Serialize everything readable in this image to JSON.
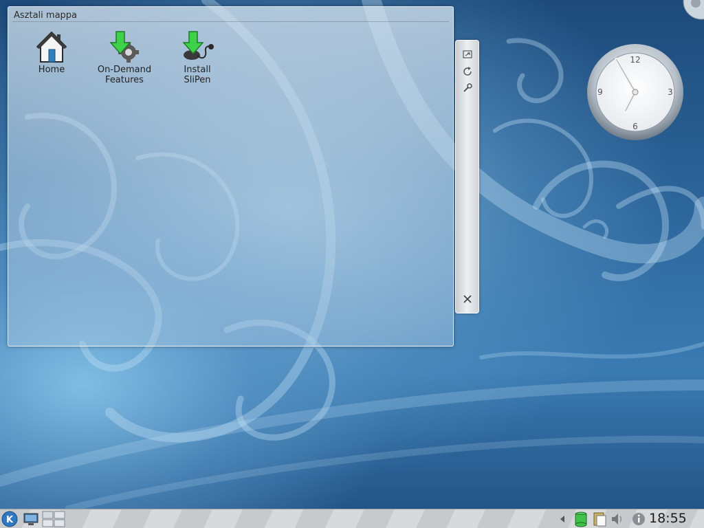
{
  "folder_view": {
    "title": "Asztali mappa",
    "icons": [
      {
        "label": "Home",
        "icon": "home-icon"
      },
      {
        "label": "On-Demand\nFeatures",
        "icon": "on-demand-features-icon"
      },
      {
        "label": "Install\nSliPen",
        "icon": "install-slipen-icon"
      }
    ]
  },
  "applet_handle": {
    "buttons": [
      "resize-icon",
      "rotate-icon",
      "configure-wrench-icon",
      "close-icon"
    ]
  },
  "analog_clock": {
    "numerals": {
      "twelve": "12",
      "three": "3",
      "six": "6",
      "nine": "9"
    },
    "hour": 6,
    "minute": 55
  },
  "taskbar": {
    "items": [
      "kde-menu-icon",
      "show-desktop-icon",
      "pager-icon"
    ],
    "tray": [
      "tray-expand-arrow-icon",
      "device-notifier-icon",
      "klipper-clipboard-icon",
      "volume-icon",
      "notifications-info-icon"
    ],
    "time": "18:55"
  },
  "colors": {
    "accent": "#3a7bb2",
    "green_arrow": "#3fd14a"
  }
}
